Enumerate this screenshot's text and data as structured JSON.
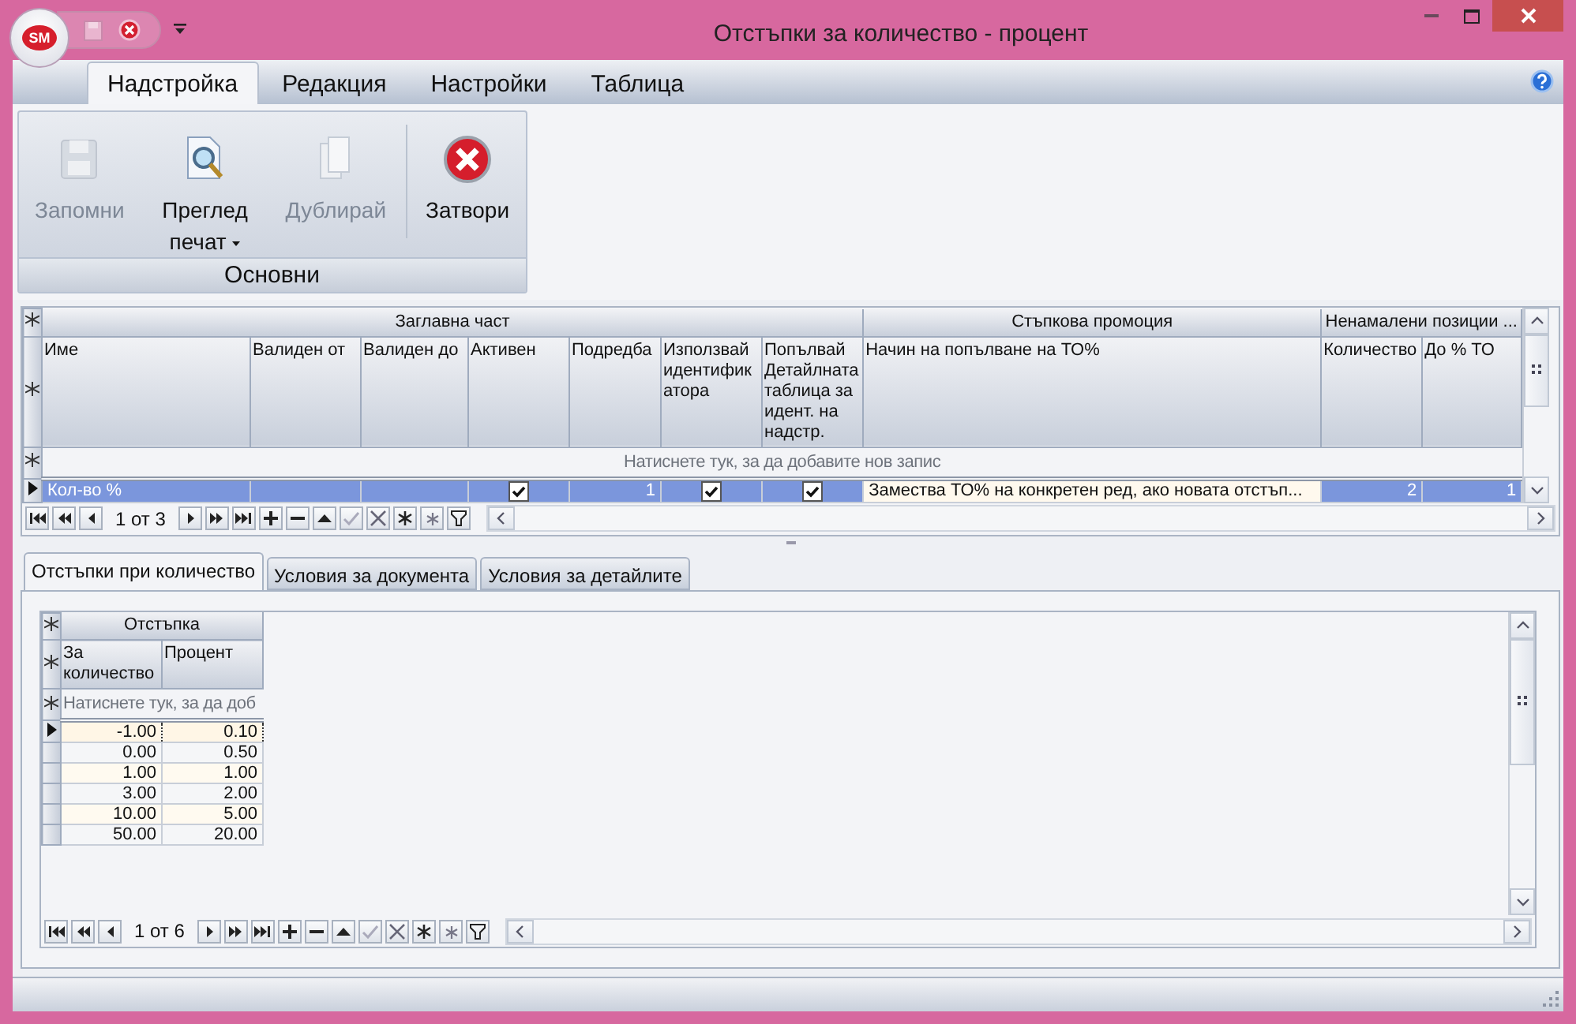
{
  "window": {
    "title": "Отстъпки за количество - процент",
    "logo": "SM"
  },
  "ribbon": {
    "tabs": [
      {
        "label": "Надстройка",
        "selected": true
      },
      {
        "label": "Редакция",
        "selected": false
      },
      {
        "label": "Настройки",
        "selected": false
      },
      {
        "label": "Таблица",
        "selected": false
      }
    ],
    "groups": [
      {
        "label": "Основни",
        "buttons": [
          {
            "kind": "save",
            "label": "Запомни",
            "disabled": true,
            "dropdown": false
          },
          {
            "kind": "preview",
            "label": "Преглед печат",
            "disabled": false,
            "dropdown": true
          },
          {
            "kind": "duplicate",
            "label": "Дублирай",
            "disabled": true,
            "dropdown": false
          },
          {
            "kind": "close",
            "label": "Затвори",
            "disabled": false,
            "dropdown": false
          }
        ]
      }
    ]
  },
  "main_grid": {
    "bands": [
      {
        "label": "Заглавна част",
        "columns": [
          "Име",
          "Валиден от",
          "Валиден до",
          "Активен",
          "Подредба",
          "Използвай идентификатора",
          "Попълвай Детайлната таблица за идент. на надстр."
        ]
      },
      {
        "label": "Стъпкова промоция",
        "columns": [
          "Начин на попълване на ТО%"
        ]
      },
      {
        "label": "Ненамалени позиции ...",
        "columns": [
          "Количество",
          "До % ТО"
        ]
      }
    ],
    "new_row_prompt": "Натиснете тук, за да добавите нов запис",
    "rows": [
      {
        "selected": true,
        "cells": [
          {
            "kind": "text",
            "value": "Кол-во %"
          },
          {
            "kind": "empty"
          },
          {
            "kind": "empty"
          },
          {
            "kind": "check",
            "checked": true
          },
          {
            "kind": "number",
            "value": "1"
          },
          {
            "kind": "check",
            "checked": true
          },
          {
            "kind": "check",
            "checked": true
          },
          {
            "kind": "text",
            "value": "Замества ТО% на конкретен ред, ако новата отстъп..."
          },
          {
            "kind": "number",
            "value": "2"
          },
          {
            "kind": "number",
            "value": "1"
          }
        ]
      }
    ],
    "position": "1 от 3"
  },
  "detail_tabs": [
    {
      "label": "Отстъпки при количество",
      "selected": true
    },
    {
      "label": "Условия за документа",
      "selected": false
    },
    {
      "label": "Условия за детайлите",
      "selected": false
    }
  ],
  "detail_grid": {
    "bands": [
      {
        "label": "Отстъпка",
        "columns": [
          "За количество",
          "Процент"
        ]
      }
    ],
    "new_row_prompt": "Натиснете тук, за да доб",
    "rows": [
      {
        "selected": true,
        "cells": [
          "-1.00",
          "0.10"
        ]
      },
      {
        "selected": false,
        "cells": [
          "0.00",
          "0.50"
        ]
      },
      {
        "selected": false,
        "cells": [
          "1.00",
          "1.00"
        ]
      },
      {
        "selected": false,
        "cells": [
          "3.00",
          "2.00"
        ]
      },
      {
        "selected": false,
        "cells": [
          "10.00",
          "5.00"
        ]
      },
      {
        "selected": false,
        "cells": [
          "50.00",
          "20.00"
        ]
      }
    ],
    "position": "1 от 6"
  }
}
